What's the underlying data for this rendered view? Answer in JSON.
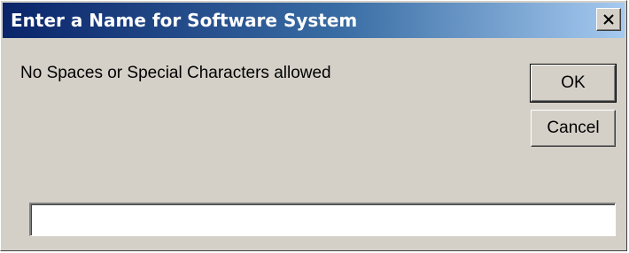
{
  "dialog": {
    "title": "Enter a Name for Software System",
    "message": "No Spaces or Special Characters allowed",
    "ok_label": "OK",
    "cancel_label": "Cancel",
    "close_label": "×",
    "input": {
      "value": "",
      "placeholder": ""
    }
  },
  "icons": {
    "close": "close-icon"
  },
  "colors": {
    "window_face": "#d4d0c8",
    "titlebar_start": "#0a246a",
    "titlebar_end": "#a6caf0",
    "title_text": "#ffffff",
    "input_background": "#ffffff"
  }
}
